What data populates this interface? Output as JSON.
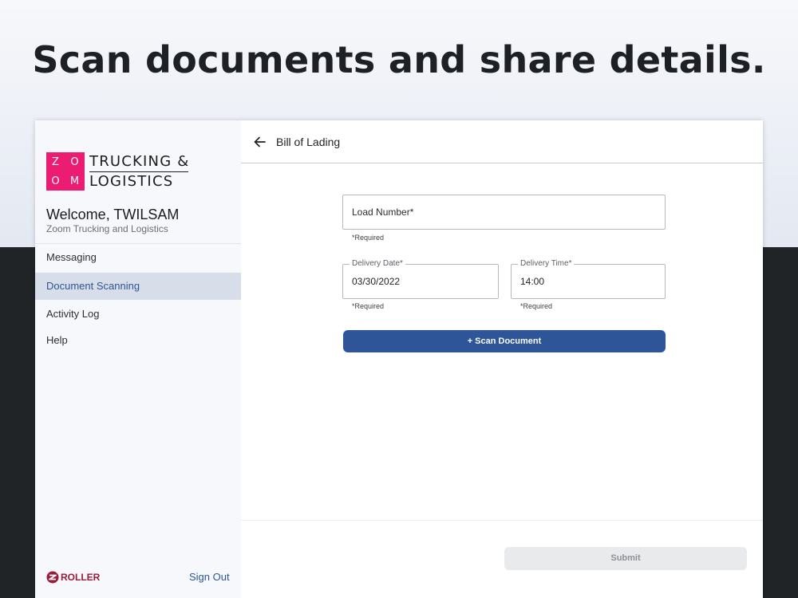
{
  "headline": "Scan documents and share details.",
  "brand": {
    "logo_letters": [
      "Z",
      "O",
      "O",
      "M"
    ],
    "logo_line1": "TRUCKING &",
    "logo_line2": "LOGISTICS",
    "accent_color": "#ec1c73"
  },
  "sidebar": {
    "welcome": "Welcome, TWILSAM",
    "company": "Zoom Trucking and Logistics",
    "items": [
      {
        "label": "Messaging",
        "active": false
      },
      {
        "label": "Document Scanning",
        "active": true
      },
      {
        "label": "Activity Log",
        "active": false
      },
      {
        "label": "Help",
        "active": false
      }
    ],
    "footer_brand": "ROLLER",
    "sign_out": "Sign Out"
  },
  "header": {
    "back_icon": "arrow-left-icon",
    "title": "Bill of Lading"
  },
  "form": {
    "load_number": {
      "placeholder": "Load Number*",
      "helper": "*Required"
    },
    "delivery_date": {
      "label": "Delivery Date*",
      "value": "03/30/2022",
      "helper": "*Required"
    },
    "delivery_time": {
      "label": "Delivery Time*",
      "value": "14:00",
      "helper": "*Required"
    },
    "scan_button": "+ Scan Document",
    "submit_button": "Submit"
  },
  "colors": {
    "primary": "#2e5597",
    "active_nav_bg": "#d7dee9",
    "disabled_button": "#e9eaec"
  }
}
